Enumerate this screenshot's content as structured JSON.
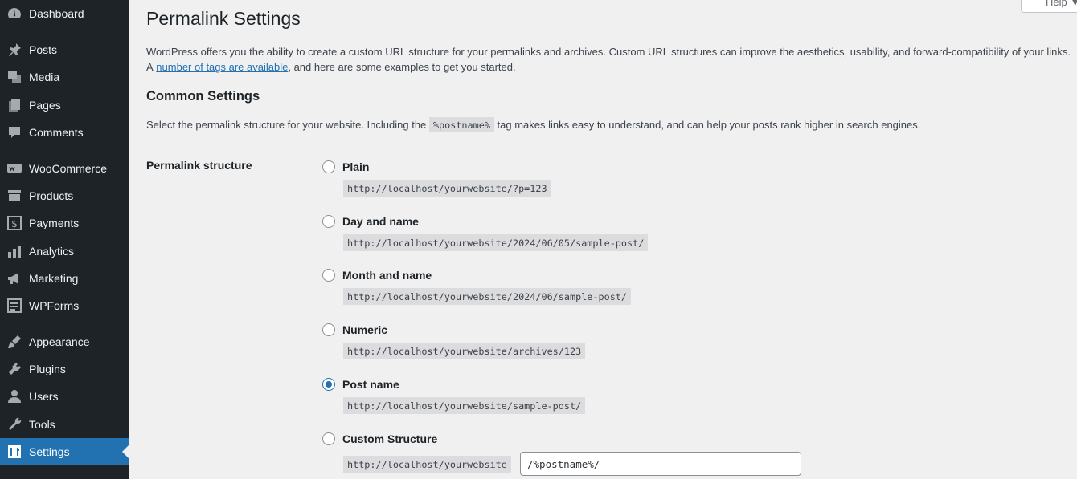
{
  "sidebar": {
    "items": [
      {
        "label": "Dashboard",
        "icon": "dashboard-icon"
      },
      {
        "label": "Posts",
        "icon": "pin-icon"
      },
      {
        "label": "Media",
        "icon": "media-icon"
      },
      {
        "label": "Pages",
        "icon": "pages-icon"
      },
      {
        "label": "Comments",
        "icon": "comment-icon"
      },
      {
        "label": "WooCommerce",
        "icon": "woo-icon"
      },
      {
        "label": "Products",
        "icon": "archive-icon"
      },
      {
        "label": "Payments",
        "icon": "dollar-icon"
      },
      {
        "label": "Analytics",
        "icon": "bar-chart-icon"
      },
      {
        "label": "Marketing",
        "icon": "megaphone-icon"
      },
      {
        "label": "WPForms",
        "icon": "form-icon"
      },
      {
        "label": "Appearance",
        "icon": "brush-icon"
      },
      {
        "label": "Plugins",
        "icon": "plug-icon"
      },
      {
        "label": "Users",
        "icon": "user-icon"
      },
      {
        "label": "Tools",
        "icon": "wrench-icon"
      },
      {
        "label": "Settings",
        "icon": "settings-icon",
        "current": true
      }
    ]
  },
  "help": {
    "label": "Help ▼"
  },
  "page": {
    "title": "Permalink Settings",
    "intro_part1": "WordPress offers you the ability to create a custom URL structure for your permalinks and archives. Custom URL structures can improve the aesthetics, usability, and forward-compatibility of your links. A",
    "intro_link": "number of tags are available",
    "intro_part2": ", and here are some examples to get you started.",
    "section_title": "Common Settings",
    "desc_part1": "Select the permalink structure for your website. Including the ",
    "desc_code": "%postname%",
    "desc_part2": " tag makes links easy to understand, and can help your posts rank higher in search engines.",
    "structure_label": "Permalink structure"
  },
  "options": [
    {
      "label": "Plain",
      "example": "http://localhost/yourwebsite/?p=123",
      "checked": false
    },
    {
      "label": "Day and name",
      "example": "http://localhost/yourwebsite/2024/06/05/sample-post/",
      "checked": false
    },
    {
      "label": "Month and name",
      "example": "http://localhost/yourwebsite/2024/06/sample-post/",
      "checked": false
    },
    {
      "label": "Numeric",
      "example": "http://localhost/yourwebsite/archives/123",
      "checked": false
    },
    {
      "label": "Post name",
      "example": "http://localhost/yourwebsite/sample-post/",
      "checked": true
    },
    {
      "label": "Custom Structure",
      "example": "http://localhost/yourwebsite",
      "checked": false
    }
  ],
  "custom_structure": {
    "value": "/%postname%/"
  },
  "colors": {
    "sidebar": "#1d2327",
    "accent": "#2271b1",
    "background": "#f0f0f1"
  }
}
